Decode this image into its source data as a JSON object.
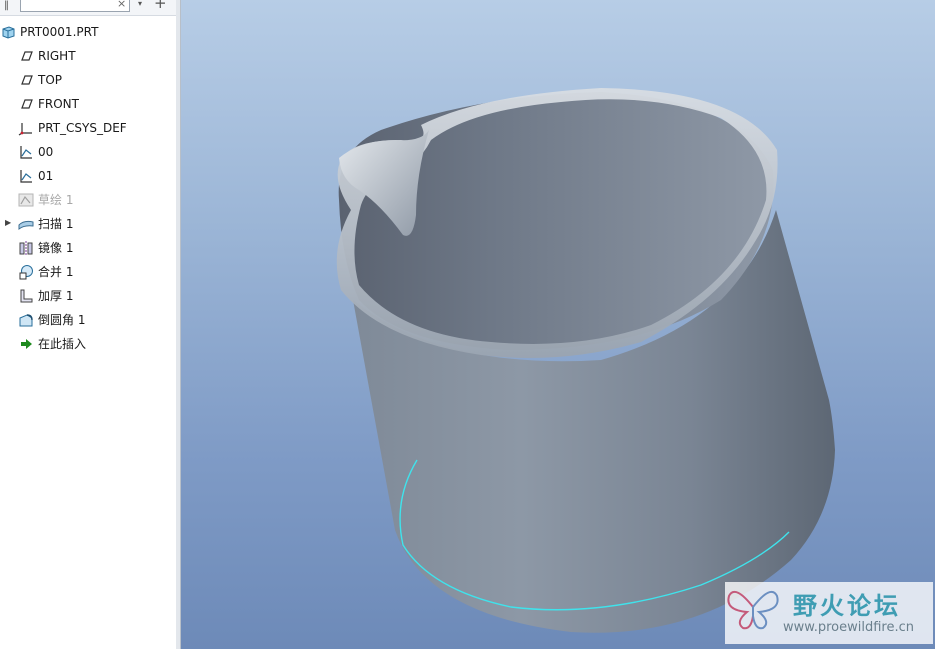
{
  "filter": {
    "value": "",
    "clear_glyph": "×",
    "dropdown_glyph": "▾",
    "add_glyph": "+"
  },
  "tree": {
    "root": {
      "label": "PRT0001.PRT",
      "icon": "part-icon"
    },
    "items": [
      {
        "label": "RIGHT",
        "icon": "datum-plane-icon"
      },
      {
        "label": "TOP",
        "icon": "datum-plane-icon"
      },
      {
        "label": "FRONT",
        "icon": "datum-plane-icon"
      },
      {
        "label": "PRT_CSYS_DEF",
        "icon": "coordinate-system-icon"
      },
      {
        "label": "00",
        "icon": "sketch-curve-icon"
      },
      {
        "label": "01",
        "icon": "sketch-curve-icon"
      },
      {
        "label": "草绘 1",
        "icon": "sketch-icon",
        "suppressed": true
      },
      {
        "label": "扫描 1",
        "icon": "sweep-icon",
        "expandable": true
      },
      {
        "label": "镜像 1",
        "icon": "mirror-icon"
      },
      {
        "label": "合并 1",
        "icon": "merge-icon"
      },
      {
        "label": "加厚 1",
        "icon": "thicken-icon"
      },
      {
        "label": "倒圆角 1",
        "icon": "round-icon"
      },
      {
        "label": "在此插入",
        "icon": "insert-here-arrow-icon"
      }
    ]
  },
  "watermark": {
    "title": "野火论坛",
    "url": "www.proewildfire.cn"
  },
  "colors": {
    "viewport_top": "#b7cde6",
    "viewport_bottom": "#6d8ab8",
    "highlight_curve": "#3fe3ec",
    "insert_arrow": "#1e8a1e"
  }
}
